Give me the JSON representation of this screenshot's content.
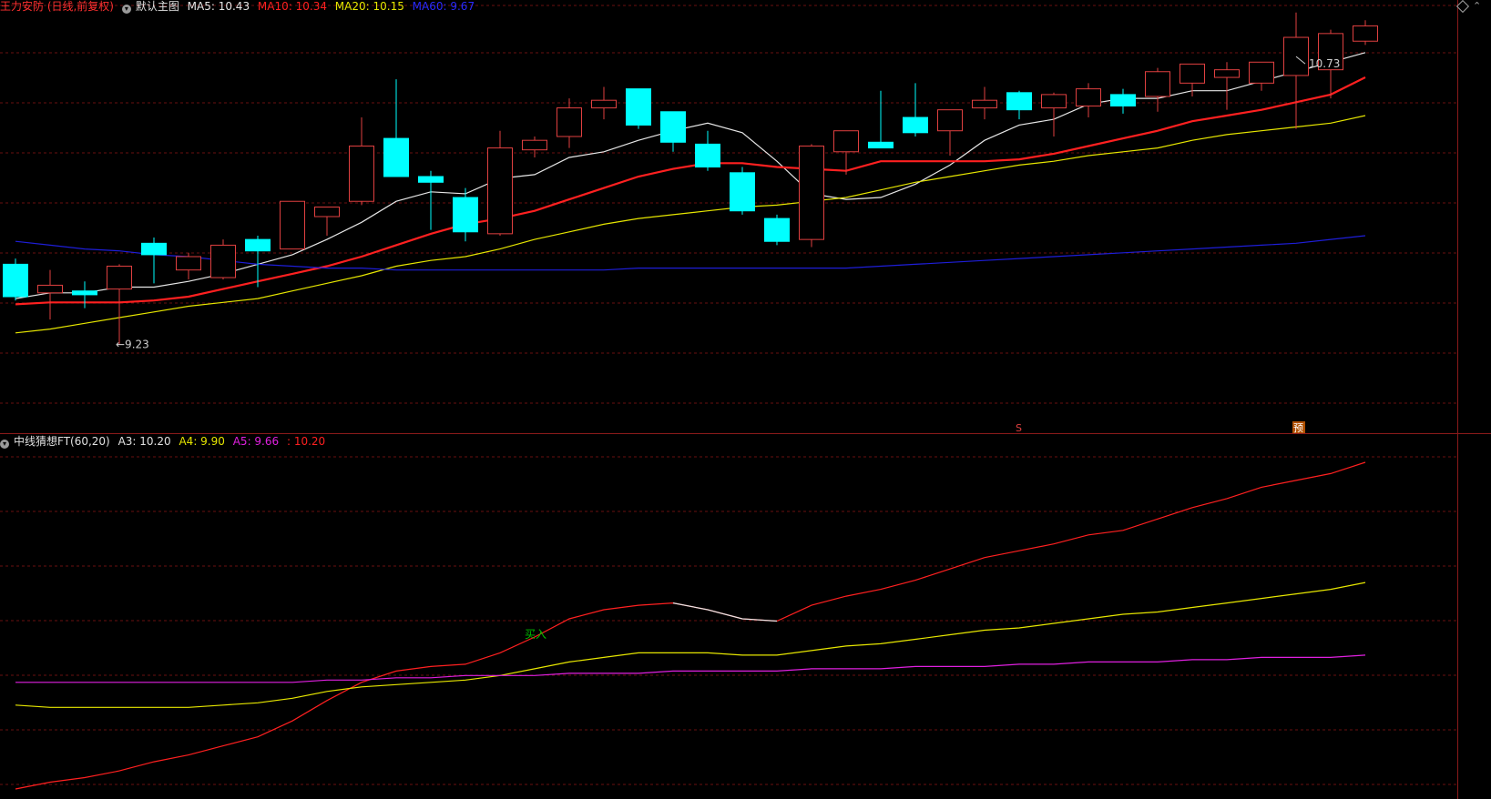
{
  "top_header": {
    "stock": "王力安防 (日线,前复权)",
    "template": "默认主图",
    "ma5": "MA5: 10.43",
    "ma10": "MA10: 10.34",
    "ma20": "MA20: 10.15",
    "ma60": "MA60: 9.67"
  },
  "bottom_header": {
    "indicator": "中线猜想FT(60,20)",
    "a3": "A3: 10.20",
    "a4": "A4: 9.90",
    "a5": "A5: 9.66",
    "extra": ": 10.20"
  },
  "icons": {
    "collapse_top": "chevron-down-icon",
    "collapse_bottom": "chevron-down-icon",
    "window_control": "diamond-icon"
  },
  "colors": {
    "up": "#e04040",
    "down": "#00ffff",
    "ma5": "#e6e6e6",
    "ma10": "#ff2020",
    "ma20": "#e6e600",
    "ma60": "#1e1ed8",
    "a3": "#ff2020",
    "a4": "#e6e600",
    "a5": "#e020e0",
    "grid": "#6a1010",
    "buy_signal": "#00c000"
  },
  "chart_data": [
    {
      "type": "candlestick",
      "title": "王力安防 (日线,前复权)",
      "ylim": [
        8.85,
        10.95
      ],
      "annotations": [
        {
          "text": "10.73",
          "index": 37,
          "value": 10.73,
          "arrow": "up-left"
        },
        {
          "text": "9.23",
          "index": 3,
          "value": 9.23,
          "arrow": "left"
        },
        {
          "text": "S",
          "index": 29,
          "color": "#e04040"
        },
        {
          "text": "预",
          "index": 37,
          "color": "#e07000"
        }
      ],
      "candles": [
        {
          "o": 9.65,
          "h": 9.68,
          "l": 9.46,
          "c": 9.48
        },
        {
          "o": 9.5,
          "h": 9.62,
          "l": 9.36,
          "c": 9.54
        },
        {
          "o": 9.51,
          "h": 9.56,
          "l": 9.42,
          "c": 9.49
        },
        {
          "o": 9.52,
          "h": 9.65,
          "l": 9.23,
          "c": 9.64
        },
        {
          "o": 9.76,
          "h": 9.79,
          "l": 9.55,
          "c": 9.7
        },
        {
          "o": 9.62,
          "h": 9.71,
          "l": 9.57,
          "c": 9.69
        },
        {
          "o": 9.58,
          "h": 9.78,
          "l": 9.57,
          "c": 9.75
        },
        {
          "o": 9.78,
          "h": 9.8,
          "l": 9.53,
          "c": 9.72
        },
        {
          "o": 9.73,
          "h": 9.94,
          "l": 9.73,
          "c": 9.98
        },
        {
          "o": 9.9,
          "h": 9.94,
          "l": 9.8,
          "c": 9.95
        },
        {
          "o": 9.98,
          "h": 10.42,
          "l": 9.96,
          "c": 10.27
        },
        {
          "o": 10.31,
          "h": 10.62,
          "l": 10.15,
          "c": 10.11
        },
        {
          "o": 10.11,
          "h": 10.14,
          "l": 9.83,
          "c": 10.08
        },
        {
          "o": 10.0,
          "h": 10.05,
          "l": 9.77,
          "c": 9.82
        },
        {
          "o": 9.81,
          "h": 10.35,
          "l": 9.8,
          "c": 10.26
        },
        {
          "o": 10.25,
          "h": 10.32,
          "l": 10.21,
          "c": 10.3
        },
        {
          "o": 10.32,
          "h": 10.52,
          "l": 10.26,
          "c": 10.47
        },
        {
          "o": 10.47,
          "h": 10.58,
          "l": 10.41,
          "c": 10.51
        },
        {
          "o": 10.57,
          "h": 10.57,
          "l": 10.36,
          "c": 10.38
        },
        {
          "o": 10.45,
          "h": 10.45,
          "l": 10.24,
          "c": 10.29
        },
        {
          "o": 10.28,
          "h": 10.35,
          "l": 10.14,
          "c": 10.16
        },
        {
          "o": 10.13,
          "h": 10.16,
          "l": 9.91,
          "c": 9.93
        },
        {
          "o": 9.89,
          "h": 9.91,
          "l": 9.75,
          "c": 9.77
        },
        {
          "o": 9.78,
          "h": 10.28,
          "l": 9.74,
          "c": 10.27
        },
        {
          "o": 10.24,
          "h": 10.35,
          "l": 10.12,
          "c": 10.35
        },
        {
          "o": 10.29,
          "h": 10.56,
          "l": 10.27,
          "c": 10.26
        },
        {
          "o": 10.42,
          "h": 10.6,
          "l": 10.32,
          "c": 10.34
        },
        {
          "o": 10.35,
          "h": 10.42,
          "l": 10.22,
          "c": 10.46
        },
        {
          "o": 10.47,
          "h": 10.58,
          "l": 10.41,
          "c": 10.51
        },
        {
          "o": 10.55,
          "h": 10.56,
          "l": 10.41,
          "c": 10.46
        },
        {
          "o": 10.47,
          "h": 10.55,
          "l": 10.32,
          "c": 10.54
        },
        {
          "o": 10.48,
          "h": 10.6,
          "l": 10.42,
          "c": 10.57
        },
        {
          "o": 10.54,
          "h": 10.57,
          "l": 10.44,
          "c": 10.48
        },
        {
          "o": 10.53,
          "h": 10.68,
          "l": 10.45,
          "c": 10.66
        },
        {
          "o": 10.6,
          "h": 10.7,
          "l": 10.53,
          "c": 10.7
        },
        {
          "o": 10.63,
          "h": 10.71,
          "l": 10.46,
          "c": 10.67
        },
        {
          "o": 10.6,
          "h": 10.71,
          "l": 10.56,
          "c": 10.71
        },
        {
          "o": 10.64,
          "h": 10.97,
          "l": 10.36,
          "c": 10.84
        },
        {
          "o": 10.67,
          "h": 10.88,
          "l": 10.52,
          "c": 10.86
        },
        {
          "o": 10.82,
          "h": 10.93,
          "l": 10.8,
          "c": 10.9
        }
      ],
      "series": [
        {
          "name": "MA5",
          "values": [
            9.47,
            9.5,
            9.5,
            9.53,
            9.53,
            9.56,
            9.6,
            9.65,
            9.7,
            9.78,
            9.87,
            9.98,
            10.03,
            10.02,
            10.1,
            10.12,
            10.21,
            10.24,
            10.3,
            10.35,
            10.39,
            10.34,
            10.19,
            10.02,
            9.99,
            10.0,
            10.07,
            10.17,
            10.3,
            10.38,
            10.41,
            10.49,
            10.52,
            10.52,
            10.56,
            10.56,
            10.61,
            10.66,
            10.71,
            10.76
          ]
        },
        {
          "name": "MA10",
          "values": [
            9.44,
            9.45,
            9.45,
            9.45,
            9.46,
            9.48,
            9.52,
            9.56,
            9.6,
            9.64,
            9.69,
            9.75,
            9.81,
            9.86,
            9.89,
            9.93,
            9.99,
            10.05,
            10.11,
            10.15,
            10.18,
            10.18,
            10.16,
            10.15,
            10.14,
            10.19,
            10.19,
            10.19,
            10.19,
            10.2,
            10.23,
            10.27,
            10.31,
            10.35,
            10.4,
            10.43,
            10.46,
            10.5,
            10.54,
            10.63
          ]
        },
        {
          "name": "MA20",
          "values": [
            9.29,
            9.31,
            9.34,
            9.37,
            9.4,
            9.43,
            9.45,
            9.47,
            9.51,
            9.55,
            9.59,
            9.64,
            9.67,
            9.69,
            9.73,
            9.78,
            9.82,
            9.86,
            9.89,
            9.91,
            9.93,
            9.95,
            9.96,
            9.98,
            10.0,
            10.04,
            10.08,
            10.11,
            10.14,
            10.17,
            10.19,
            10.22,
            10.24,
            10.26,
            10.3,
            10.33,
            10.35,
            10.37,
            10.39,
            10.43
          ]
        },
        {
          "name": "MA60",
          "values": [
            9.77,
            9.75,
            9.73,
            9.72,
            9.7,
            9.69,
            9.67,
            9.65,
            9.64,
            9.63,
            9.63,
            9.62,
            9.62,
            9.62,
            9.62,
            9.62,
            9.62,
            9.62,
            9.63,
            9.63,
            9.63,
            9.63,
            9.63,
            9.63,
            9.63,
            9.64,
            9.65,
            9.66,
            9.67,
            9.68,
            9.69,
            9.7,
            9.71,
            9.72,
            9.73,
            9.74,
            9.75,
            9.76,
            9.78,
            9.8
          ]
        }
      ]
    },
    {
      "type": "line",
      "title": "中线猜想FT(60,20)",
      "ylim": [
        9.05,
        10.55
      ],
      "annotations": [
        {
          "text": "买入",
          "index": 15,
          "value": 9.72
        }
      ],
      "series": [
        {
          "name": "A3",
          "values": [
            9.07,
            9.1,
            9.12,
            9.15,
            9.19,
            9.22,
            9.26,
            9.3,
            9.37,
            9.46,
            9.54,
            9.59,
            9.61,
            9.62,
            9.67,
            9.74,
            9.82,
            9.86,
            9.88,
            9.89,
            9.86,
            9.82,
            9.81,
            9.88,
            9.92,
            9.95,
            9.99,
            10.04,
            10.09,
            10.12,
            10.15,
            10.19,
            10.21,
            10.26,
            10.31,
            10.35,
            10.4,
            10.43,
            10.46,
            10.51
          ]
        },
        {
          "name": "A4",
          "values": [
            9.44,
            9.43,
            9.43,
            9.43,
            9.43,
            9.43,
            9.44,
            9.45,
            9.47,
            9.5,
            9.52,
            9.53,
            9.54,
            9.55,
            9.57,
            9.6,
            9.63,
            9.65,
            9.67,
            9.67,
            9.67,
            9.66,
            9.66,
            9.68,
            9.7,
            9.71,
            9.73,
            9.75,
            9.77,
            9.78,
            9.8,
            9.82,
            9.84,
            9.85,
            9.87,
            9.89,
            9.91,
            9.93,
            9.95,
            9.98
          ]
        },
        {
          "name": "A5",
          "values": [
            9.54,
            9.54,
            9.54,
            9.54,
            9.54,
            9.54,
            9.54,
            9.54,
            9.54,
            9.55,
            9.55,
            9.56,
            9.56,
            9.57,
            9.57,
            9.57,
            9.58,
            9.58,
            9.58,
            9.59,
            9.59,
            9.59,
            9.59,
            9.6,
            9.6,
            9.6,
            9.61,
            9.61,
            9.61,
            9.62,
            9.62,
            9.63,
            9.63,
            9.63,
            9.64,
            9.64,
            9.65,
            9.65,
            9.65,
            9.66
          ]
        }
      ]
    }
  ]
}
